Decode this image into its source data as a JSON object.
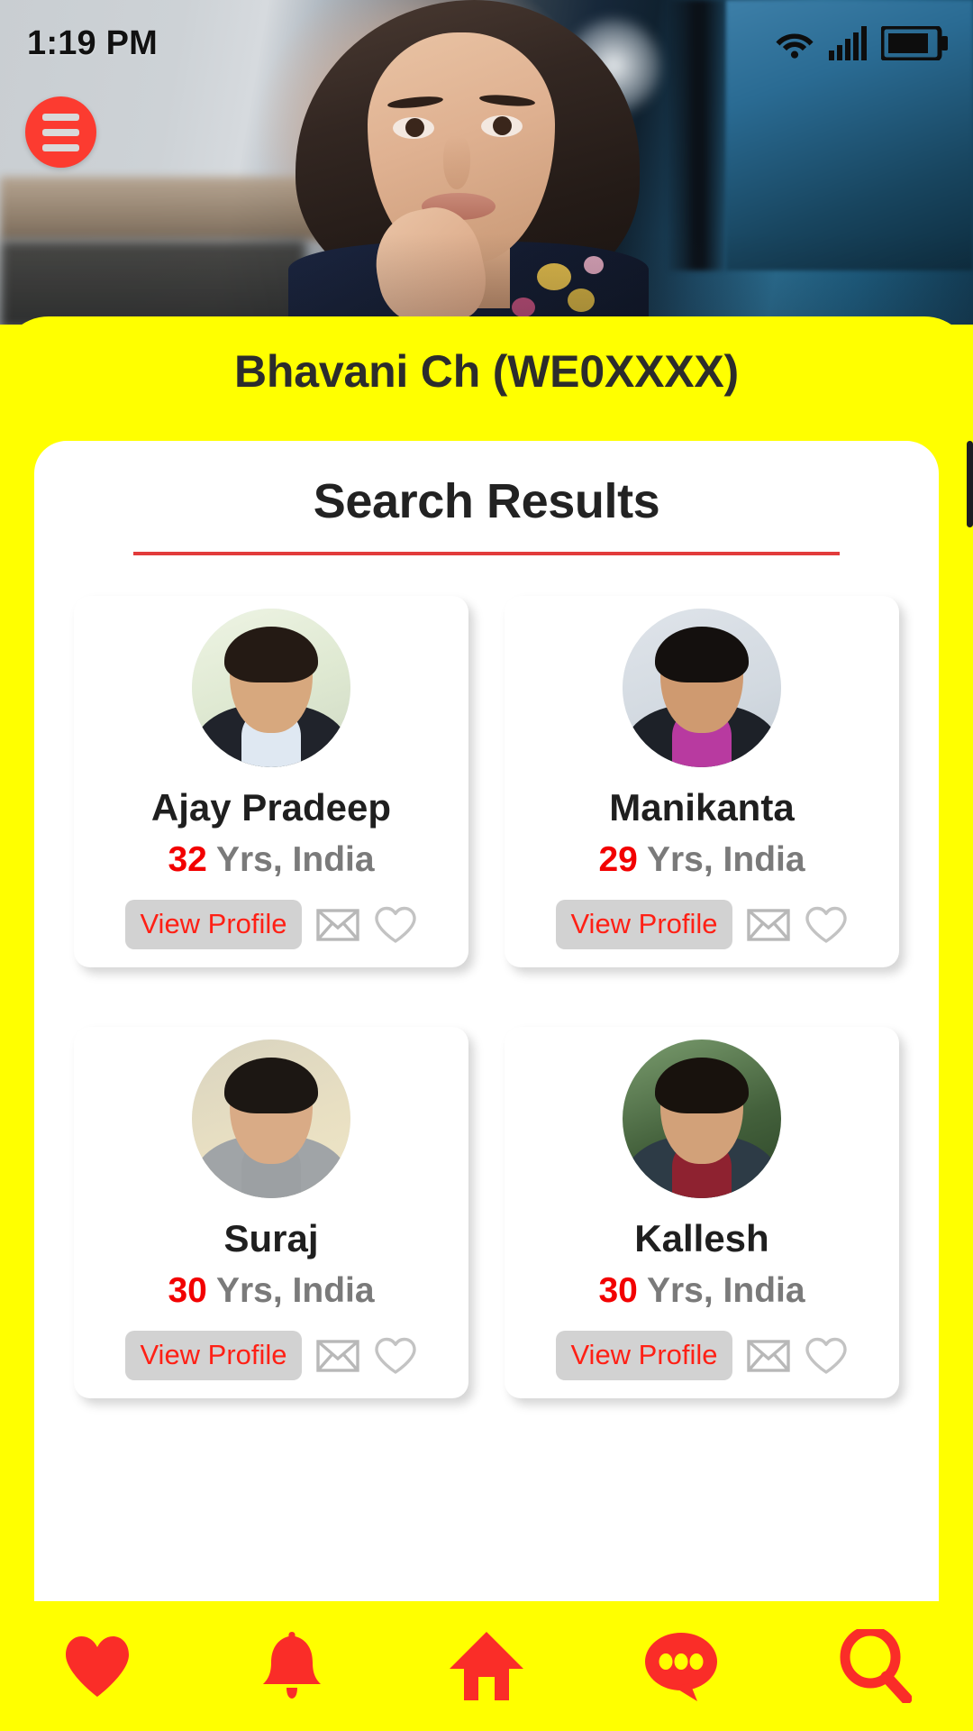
{
  "status_bar": {
    "time": "1:19 PM",
    "icons": [
      "wifi-icon",
      "cellular-signal-icon",
      "battery-icon"
    ]
  },
  "header": {
    "menu_icon": "hamburger-menu-icon",
    "banner_title": "Bhavani Ch (WE0XXXX)"
  },
  "main": {
    "title": "Search Results",
    "profiles": [
      {
        "name": "Ajay Pradeep",
        "age": "32",
        "age_suffix": "Yrs, India",
        "view_label": "View Profile",
        "avatar": {
          "bg": "#eef2e6",
          "hair": "#241a14",
          "skin": "#d7a87e",
          "body": "#20232b",
          "shirt": "#dfe8f2"
        }
      },
      {
        "name": "Manikanta",
        "age": "29",
        "age_suffix": "Yrs, India",
        "view_label": "View Profile",
        "avatar": {
          "bg": "#d8dde3",
          "hair": "#14100e",
          "skin": "#cf9a70",
          "body": "#1d2128",
          "shirt": "#b83aa0"
        }
      },
      {
        "name": "Suraj",
        "age": "30",
        "age_suffix": "Yrs, India",
        "view_label": "View Profile",
        "avatar": {
          "bg": "#e6dcc2",
          "hair": "#1c1713",
          "skin": "#d9ab86",
          "body": "#9ca0a3",
          "shirt": "#a9adb0"
        }
      },
      {
        "name": "Kallesh",
        "age": "30",
        "age_suffix": "Yrs, India",
        "view_label": "View Profile",
        "avatar": {
          "bg": "#3f5b3a",
          "hair": "#18120d",
          "skin": "#d2a179",
          "body": "#2d3b46",
          "shirt": "#8e2230"
        }
      }
    ],
    "action_icons": [
      "envelope-icon",
      "heart-outline-icon"
    ]
  },
  "bottom_nav": {
    "items": [
      {
        "icon": "heart-icon",
        "label": "Favourites"
      },
      {
        "icon": "bell-icon",
        "label": "Notifications"
      },
      {
        "icon": "home-icon",
        "label": "Home"
      },
      {
        "icon": "chat-icon",
        "label": "Messages"
      },
      {
        "icon": "search-icon",
        "label": "Search"
      }
    ]
  },
  "colors": {
    "brand_yellow": "#ffff00",
    "brand_red": "#fc3b30",
    "accent_red": "#f20000",
    "divider_red": "#e23b3b",
    "button_gray": "#d2d2d2",
    "muted_text": "#7a7a7a"
  }
}
